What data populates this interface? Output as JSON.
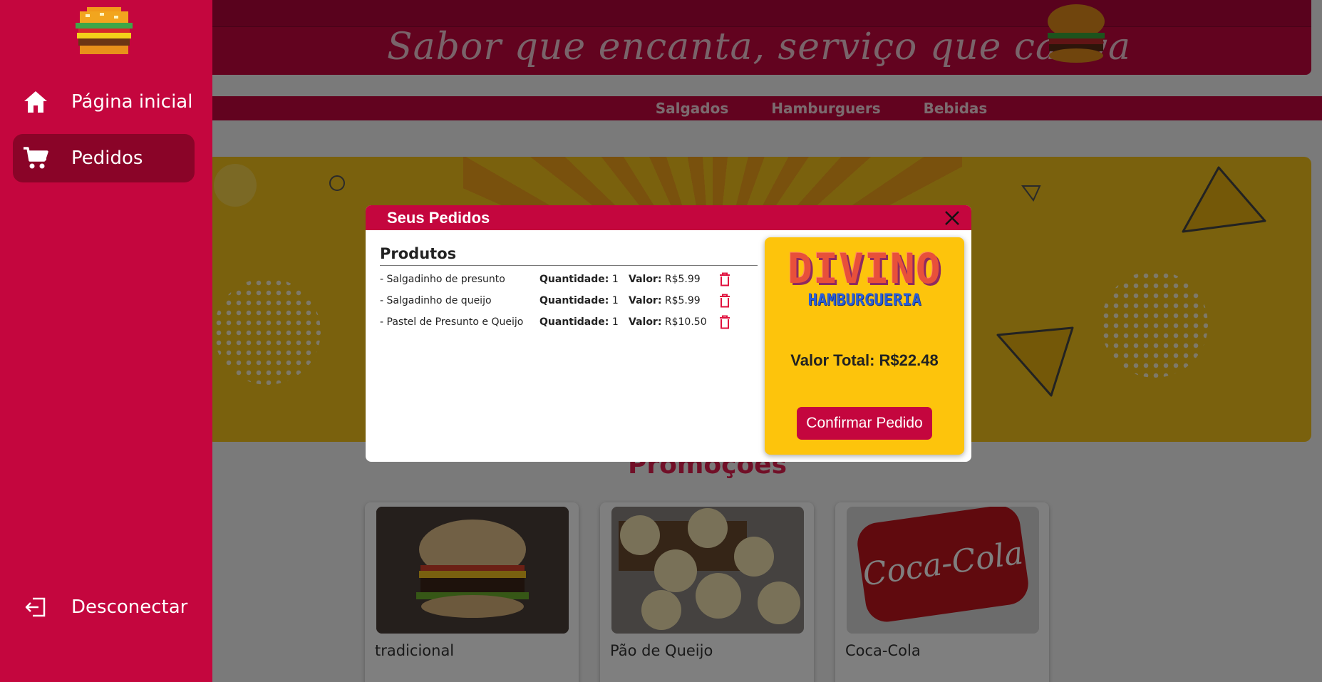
{
  "header": {
    "slogan": "Sabor que encanta, serviço que cativa"
  },
  "nav": {
    "items": [
      {
        "label": "Salgados"
      },
      {
        "label": "Hamburguers"
      },
      {
        "label": "Bebidas"
      }
    ]
  },
  "sidebar": {
    "items": [
      {
        "label": "Página inicial",
        "icon": "home-icon",
        "active": false
      },
      {
        "label": "Pedidos",
        "icon": "cart-icon",
        "active": true
      }
    ],
    "logout": {
      "label": "Desconectar",
      "icon": "logout-icon"
    }
  },
  "promotions": {
    "title": "Promoções",
    "cards": [
      {
        "label": "tradicional"
      },
      {
        "label": "Pão de Queijo"
      },
      {
        "label": "Coca-Cola"
      }
    ]
  },
  "modal": {
    "title": "Seus Pedidos",
    "products_heading": "Produtos",
    "qty_label": "Quantidade:",
    "value_label": "Valor:",
    "products": [
      {
        "name": "- Salgadinho de presunto",
        "qty": "1",
        "value": "R$5.99"
      },
      {
        "name": "- Salgadinho de queijo",
        "qty": "1",
        "value": "R$5.99"
      },
      {
        "name": "- Pastel de Presunto e Queijo",
        "qty": "1",
        "value": "R$10.50"
      }
    ],
    "brand": {
      "main": "DIVINO",
      "sub": "HAMBURGUERIA"
    },
    "total_text": "Valor Total: R$22.48",
    "confirm_label": "Confirmar Pedido"
  },
  "colors": {
    "brand_red": "#c4063e",
    "sidebar_active": "#8a0428",
    "panel_yellow": "#fdc40c",
    "trash_red": "#e0103e"
  }
}
